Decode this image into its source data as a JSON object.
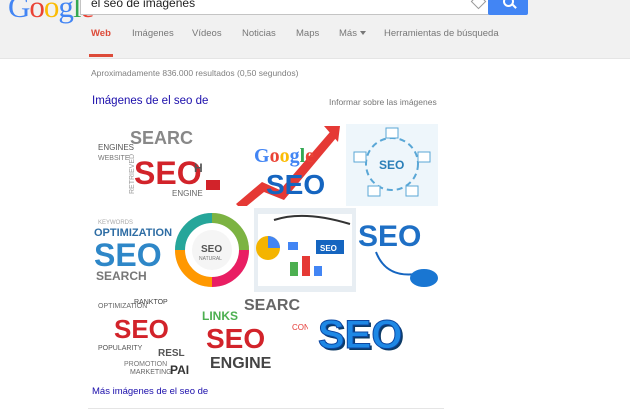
{
  "header": {
    "logo_text": "Google",
    "search_value": "el seo de imágenes",
    "search_button_icon": "search-icon"
  },
  "tabs": [
    {
      "label": "Web",
      "active": true
    },
    {
      "label": "Imágenes",
      "active": false
    },
    {
      "label": "Vídeos",
      "active": false
    },
    {
      "label": "Noticias",
      "active": false
    },
    {
      "label": "Maps",
      "active": false
    },
    {
      "label": "Más",
      "active": false
    },
    {
      "label": "Herramientas de búsqueda",
      "active": false
    }
  ],
  "results": {
    "stats": "Aproximadamente 836.000 resultados (0,50 segundos)",
    "images_heading": "Imágenes de el seo de",
    "report_link": "Informar sobre las imágenes",
    "more_images_link": "Más imágenes de el seo de"
  },
  "colors": {
    "google_blue": "#4285f4",
    "active_tab_red": "#dd4b39",
    "link_blue": "#1a0dab"
  }
}
